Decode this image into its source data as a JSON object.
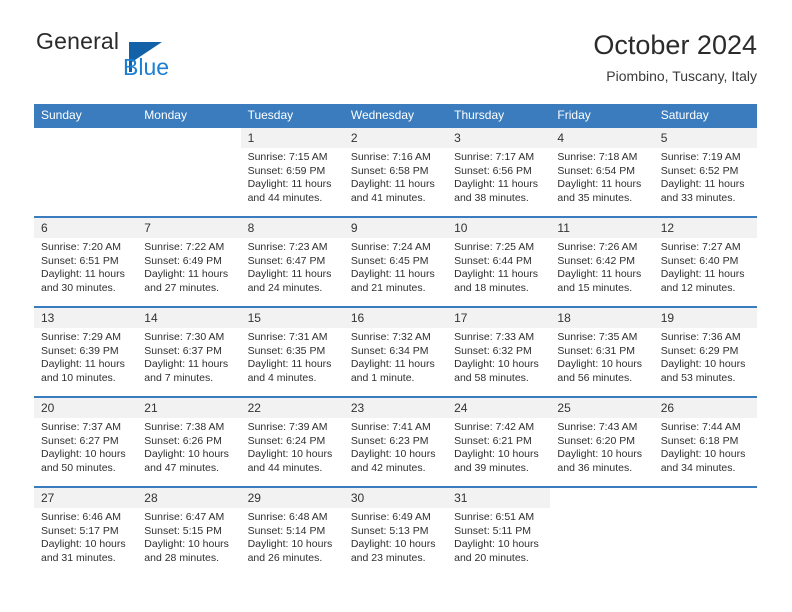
{
  "brand": {
    "name_top": "General",
    "name_bottom": "Blue",
    "flag_color": "#1362a8",
    "blue_color": "#1b7fd4"
  },
  "header": {
    "title": "October 2024",
    "subtitle": "Piombino, Tuscany, Italy"
  },
  "theme": {
    "header_bg": "#3a7cbe",
    "header_text": "#ffffff",
    "daynum_bg": "#f2f2f2",
    "row_rule": "#3a7cbe"
  },
  "weekdays": [
    "Sunday",
    "Monday",
    "Tuesday",
    "Wednesday",
    "Thursday",
    "Friday",
    "Saturday"
  ],
  "calendar": {
    "weeks": [
      [
        {
          "day": "",
          "empty": true
        },
        {
          "day": "",
          "empty": true
        },
        {
          "day": "1",
          "sunrise": "Sunrise: 7:15 AM",
          "sunset": "Sunset: 6:59 PM",
          "daylight": "Daylight: 11 hours and 44 minutes."
        },
        {
          "day": "2",
          "sunrise": "Sunrise: 7:16 AM",
          "sunset": "Sunset: 6:58 PM",
          "daylight": "Daylight: 11 hours and 41 minutes."
        },
        {
          "day": "3",
          "sunrise": "Sunrise: 7:17 AM",
          "sunset": "Sunset: 6:56 PM",
          "daylight": "Daylight: 11 hours and 38 minutes."
        },
        {
          "day": "4",
          "sunrise": "Sunrise: 7:18 AM",
          "sunset": "Sunset: 6:54 PM",
          "daylight": "Daylight: 11 hours and 35 minutes."
        },
        {
          "day": "5",
          "sunrise": "Sunrise: 7:19 AM",
          "sunset": "Sunset: 6:52 PM",
          "daylight": "Daylight: 11 hours and 33 minutes."
        }
      ],
      [
        {
          "day": "6",
          "sunrise": "Sunrise: 7:20 AM",
          "sunset": "Sunset: 6:51 PM",
          "daylight": "Daylight: 11 hours and 30 minutes."
        },
        {
          "day": "7",
          "sunrise": "Sunrise: 7:22 AM",
          "sunset": "Sunset: 6:49 PM",
          "daylight": "Daylight: 11 hours and 27 minutes."
        },
        {
          "day": "8",
          "sunrise": "Sunrise: 7:23 AM",
          "sunset": "Sunset: 6:47 PM",
          "daylight": "Daylight: 11 hours and 24 minutes."
        },
        {
          "day": "9",
          "sunrise": "Sunrise: 7:24 AM",
          "sunset": "Sunset: 6:45 PM",
          "daylight": "Daylight: 11 hours and 21 minutes."
        },
        {
          "day": "10",
          "sunrise": "Sunrise: 7:25 AM",
          "sunset": "Sunset: 6:44 PM",
          "daylight": "Daylight: 11 hours and 18 minutes."
        },
        {
          "day": "11",
          "sunrise": "Sunrise: 7:26 AM",
          "sunset": "Sunset: 6:42 PM",
          "daylight": "Daylight: 11 hours and 15 minutes."
        },
        {
          "day": "12",
          "sunrise": "Sunrise: 7:27 AM",
          "sunset": "Sunset: 6:40 PM",
          "daylight": "Daylight: 11 hours and 12 minutes."
        }
      ],
      [
        {
          "day": "13",
          "sunrise": "Sunrise: 7:29 AM",
          "sunset": "Sunset: 6:39 PM",
          "daylight": "Daylight: 11 hours and 10 minutes."
        },
        {
          "day": "14",
          "sunrise": "Sunrise: 7:30 AM",
          "sunset": "Sunset: 6:37 PM",
          "daylight": "Daylight: 11 hours and 7 minutes."
        },
        {
          "day": "15",
          "sunrise": "Sunrise: 7:31 AM",
          "sunset": "Sunset: 6:35 PM",
          "daylight": "Daylight: 11 hours and 4 minutes."
        },
        {
          "day": "16",
          "sunrise": "Sunrise: 7:32 AM",
          "sunset": "Sunset: 6:34 PM",
          "daylight": "Daylight: 11 hours and 1 minute."
        },
        {
          "day": "17",
          "sunrise": "Sunrise: 7:33 AM",
          "sunset": "Sunset: 6:32 PM",
          "daylight": "Daylight: 10 hours and 58 minutes."
        },
        {
          "day": "18",
          "sunrise": "Sunrise: 7:35 AM",
          "sunset": "Sunset: 6:31 PM",
          "daylight": "Daylight: 10 hours and 56 minutes."
        },
        {
          "day": "19",
          "sunrise": "Sunrise: 7:36 AM",
          "sunset": "Sunset: 6:29 PM",
          "daylight": "Daylight: 10 hours and 53 minutes."
        }
      ],
      [
        {
          "day": "20",
          "sunrise": "Sunrise: 7:37 AM",
          "sunset": "Sunset: 6:27 PM",
          "daylight": "Daylight: 10 hours and 50 minutes."
        },
        {
          "day": "21",
          "sunrise": "Sunrise: 7:38 AM",
          "sunset": "Sunset: 6:26 PM",
          "daylight": "Daylight: 10 hours and 47 minutes."
        },
        {
          "day": "22",
          "sunrise": "Sunrise: 7:39 AM",
          "sunset": "Sunset: 6:24 PM",
          "daylight": "Daylight: 10 hours and 44 minutes."
        },
        {
          "day": "23",
          "sunrise": "Sunrise: 7:41 AM",
          "sunset": "Sunset: 6:23 PM",
          "daylight": "Daylight: 10 hours and 42 minutes."
        },
        {
          "day": "24",
          "sunrise": "Sunrise: 7:42 AM",
          "sunset": "Sunset: 6:21 PM",
          "daylight": "Daylight: 10 hours and 39 minutes."
        },
        {
          "day": "25",
          "sunrise": "Sunrise: 7:43 AM",
          "sunset": "Sunset: 6:20 PM",
          "daylight": "Daylight: 10 hours and 36 minutes."
        },
        {
          "day": "26",
          "sunrise": "Sunrise: 7:44 AM",
          "sunset": "Sunset: 6:18 PM",
          "daylight": "Daylight: 10 hours and 34 minutes."
        }
      ],
      [
        {
          "day": "27",
          "sunrise": "Sunrise: 6:46 AM",
          "sunset": "Sunset: 5:17 PM",
          "daylight": "Daylight: 10 hours and 31 minutes."
        },
        {
          "day": "28",
          "sunrise": "Sunrise: 6:47 AM",
          "sunset": "Sunset: 5:15 PM",
          "daylight": "Daylight: 10 hours and 28 minutes."
        },
        {
          "day": "29",
          "sunrise": "Sunrise: 6:48 AM",
          "sunset": "Sunset: 5:14 PM",
          "daylight": "Daylight: 10 hours and 26 minutes."
        },
        {
          "day": "30",
          "sunrise": "Sunrise: 6:49 AM",
          "sunset": "Sunset: 5:13 PM",
          "daylight": "Daylight: 10 hours and 23 minutes."
        },
        {
          "day": "31",
          "sunrise": "Sunrise: 6:51 AM",
          "sunset": "Sunset: 5:11 PM",
          "daylight": "Daylight: 10 hours and 20 minutes."
        },
        {
          "day": "",
          "empty": true
        },
        {
          "day": "",
          "empty": true
        }
      ]
    ]
  }
}
